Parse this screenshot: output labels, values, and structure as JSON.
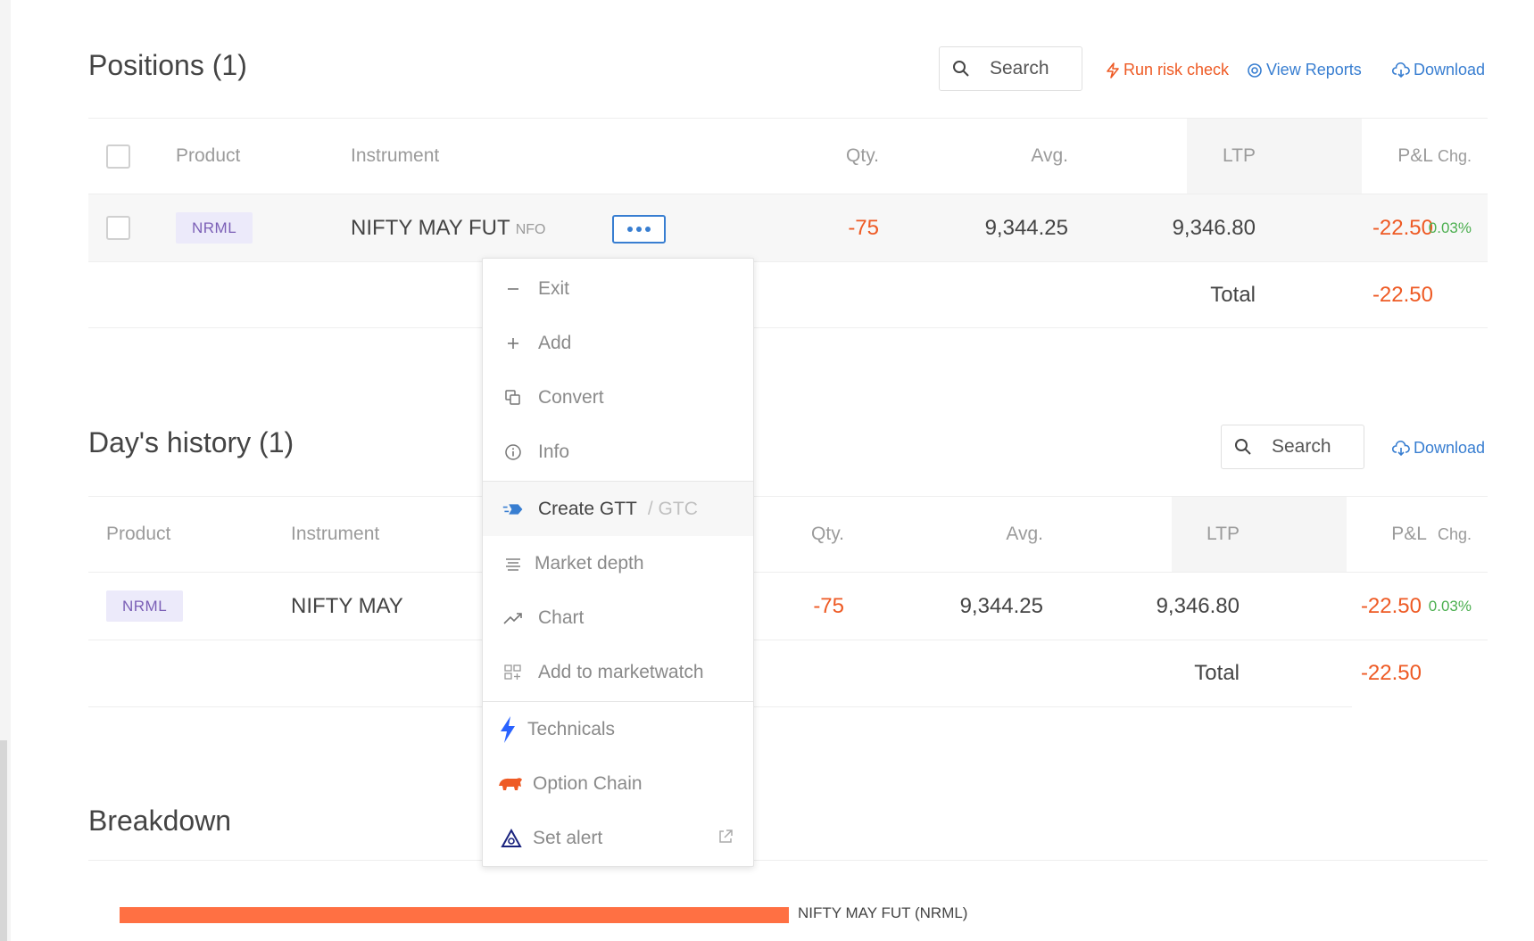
{
  "positions": {
    "title": "Positions (1)",
    "search_placeholder": "Search",
    "actions": {
      "risk": "Run risk check",
      "reports": "View Reports",
      "download": "Download"
    },
    "columns": {
      "product": "Product",
      "instrument": "Instrument",
      "qty": "Qty.",
      "avg": "Avg.",
      "ltp": "LTP",
      "pnl": "P&L",
      "chg": "Chg."
    },
    "row": {
      "product": "NRML",
      "instrument": "NIFTY MAY FUT",
      "exchange": "NFO",
      "qty": "-75",
      "avg": "9,344.25",
      "ltp": "9,346.80",
      "pnl": "-22.50",
      "chg": "0.03%"
    },
    "total_label": "Total",
    "total_value": "-22.50"
  },
  "history": {
    "title": "Day's history (1)",
    "search_placeholder": "Search",
    "actions": {
      "download": "Download"
    },
    "columns": {
      "product": "Product",
      "instrument": "Instrument",
      "qty": "Qty.",
      "avg": "Avg.",
      "ltp": "LTP",
      "pnl": "P&L",
      "chg": "Chg."
    },
    "row": {
      "product": "NRML",
      "instrument": "NIFTY MAY",
      "qty": "-75",
      "avg": "9,344.25",
      "ltp": "9,346.80",
      "pnl": "-22.50",
      "chg": "0.03%"
    },
    "total_label": "Total",
    "total_value": "-22.50"
  },
  "breakdown": {
    "title": "Breakdown",
    "bar_label": "NIFTY MAY FUT (NRML)",
    "bar_color": "#ff7043"
  },
  "menu": {
    "items": {
      "exit": "Exit",
      "add": "Add",
      "convert": "Convert",
      "info": "Info",
      "create_gtt": "Create GTT",
      "gtc": "/ GTC",
      "market_depth": "Market depth",
      "chart": "Chart",
      "add_marketwatch": "Add to marketwatch",
      "technicals": "Technicals",
      "option_chain": "Option Chain",
      "set_alert": "Set alert"
    }
  },
  "colors": {
    "accent": "#387ed1",
    "loss": "#ee5a24",
    "gain": "#4caf50",
    "badge_bg": "#eceafa",
    "badge_text": "#7b5fb6"
  }
}
